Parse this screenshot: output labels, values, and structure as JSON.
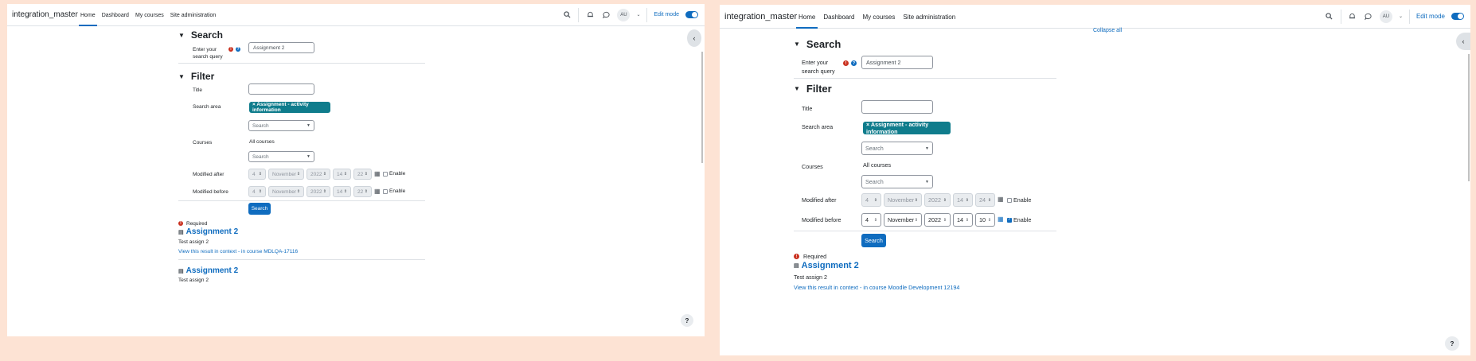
{
  "left": {
    "brand": "integration_master",
    "nav": [
      "Home",
      "Dashboard",
      "My courses",
      "Site administration"
    ],
    "avatar": "AU",
    "edit_mode": "Edit mode",
    "search_section": "Search",
    "query_label": "Enter your search query",
    "query_value": "Assignment 2",
    "filter_section": "Filter",
    "title_label": "Title",
    "title_value": "",
    "search_area_label": "Search area",
    "search_area_tag": "× Assignment - activity information",
    "search_placeholder": "Search",
    "courses_label": "Courses",
    "courses_value": "All courses",
    "modified_after_label": "Modified after",
    "modified_before_label": "Modified before",
    "after": {
      "day": "4",
      "month": "November",
      "year": "2022",
      "hour": "14",
      "minute": "22",
      "enabled": false
    },
    "before": {
      "day": "4",
      "month": "November",
      "year": "2022",
      "hour": "14",
      "minute": "22",
      "enabled": false
    },
    "enable_label": "Enable",
    "search_button": "Search",
    "required_label": "Required",
    "results": [
      {
        "title": "Assignment 2",
        "text": "Test assign 2",
        "link": "View this result in context",
        "course": " - in course MDLQA-17116"
      },
      {
        "title": "Assignment 2",
        "text": "Test assign 2"
      }
    ],
    "help": "?"
  },
  "right": {
    "brand": "integration_master",
    "nav": [
      "Home",
      "Dashboard",
      "My courses",
      "Site administration"
    ],
    "avatar": "AU",
    "edit_mode": "Edit mode",
    "collapse_all": "Collapse all",
    "search_section": "Search",
    "query_label": "Enter your search query",
    "query_value": "Assignment 2",
    "filter_section": "Filter",
    "title_label": "Title",
    "title_value": "",
    "search_area_label": "Search area",
    "search_area_tag": "× Assignment - activity information",
    "search_placeholder": "Search",
    "courses_label": "Courses",
    "courses_value": "All courses",
    "modified_after_label": "Modified after",
    "modified_before_label": "Modified before",
    "after": {
      "day": "4",
      "month": "November",
      "year": "2022",
      "hour": "14",
      "minute": "24",
      "enabled": false
    },
    "before": {
      "day": "4",
      "month": "November",
      "year": "2022",
      "hour": "14",
      "minute": "10",
      "enabled": true
    },
    "enable_label": "Enable",
    "search_button": "Search",
    "required_label": "Required",
    "results": [
      {
        "title": "Assignment 2",
        "text": "Test assign 2",
        "link": "View this result in context",
        "course": " - in course Moodle Development 12194"
      }
    ],
    "help": "?"
  },
  "colors": {
    "primary": "#0f6cbf",
    "tag": "#0f7c8c",
    "error": "#ca3120",
    "background": "#fde3d4"
  }
}
